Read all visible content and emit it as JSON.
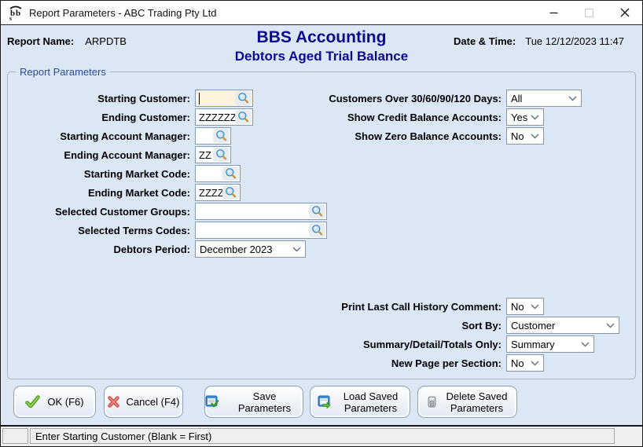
{
  "window": {
    "title": "Report Parameters - ABC Trading Pty Ltd"
  },
  "header": {
    "report_name_label": "Report Name:",
    "report_name_value": "ARPDTB",
    "app_title": "BBS Accounting",
    "report_title": "Debtors Aged Trial Balance",
    "datetime_label": "Date & Time:",
    "datetime_value": "Tue 12/12/2023 11:47"
  },
  "group": {
    "label": "Report Parameters"
  },
  "fields": {
    "left": [
      {
        "label": "Starting Customer:",
        "value": ""
      },
      {
        "label": "Ending Customer:",
        "value": "ZZZZZZ"
      },
      {
        "label": "Starting Account Manager:",
        "value": ""
      },
      {
        "label": "Ending Account Manager:",
        "value": "ZZ"
      },
      {
        "label": "Starting Market Code:",
        "value": ""
      },
      {
        "label": "Ending Market Code:",
        "value": "ZZZZ"
      },
      {
        "label": "Selected Customer Groups:",
        "value": ""
      },
      {
        "label": "Selected Terms Codes:",
        "value": ""
      },
      {
        "label": "Debtors Period:",
        "value": "December 2023"
      }
    ],
    "right_top": [
      {
        "label": "Customers Over 30/60/90/120 Days:",
        "value": "All"
      },
      {
        "label": "Show Credit Balance Accounts:",
        "value": "Yes"
      },
      {
        "label": "Show Zero Balance Accounts:",
        "value": "No"
      }
    ],
    "right_bottom": [
      {
        "label": "Print Last Call History Comment:",
        "value": "No"
      },
      {
        "label": "Sort By:",
        "value": "Customer"
      },
      {
        "label": "Summary/Detail/Totals Only:",
        "value": "Summary"
      },
      {
        "label": "New Page per Section:",
        "value": "No"
      }
    ]
  },
  "buttons": {
    "ok": "OK (F6)",
    "cancel": "Cancel (F4)",
    "save": "Save Parameters",
    "load": "Load Saved Parameters",
    "delete": "Delete Saved Parameters"
  },
  "statusbar": {
    "message": "Enter Starting Customer (Blank = First)"
  },
  "colors": {
    "title_navy": "#0a0a8f",
    "group_label_blue": "#2b4a9b",
    "focused_field_bg": "#fdf3dc",
    "ok_green": "#57a829",
    "cancel_red": "#d9534f",
    "body_blue": "#dce7f5"
  }
}
